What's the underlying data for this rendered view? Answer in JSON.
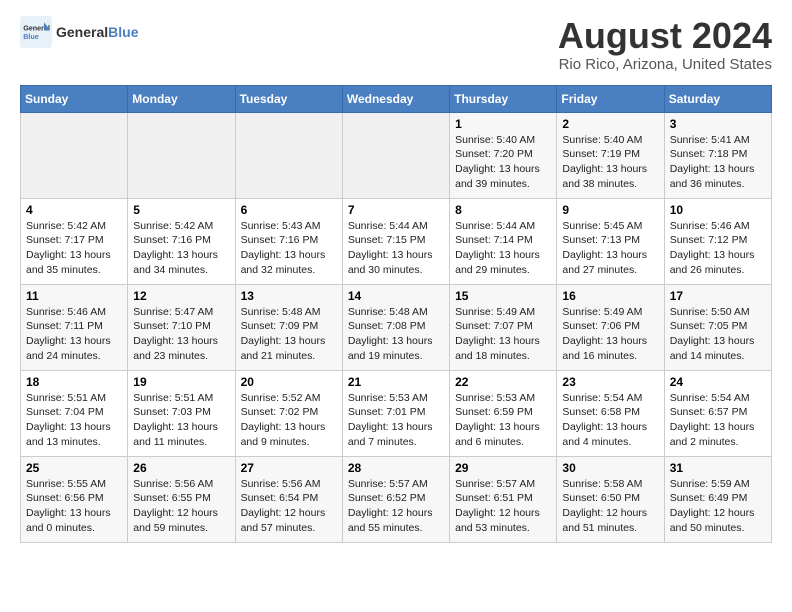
{
  "header": {
    "logo_line1": "General",
    "logo_line2": "Blue",
    "month_title": "August 2024",
    "location": "Rio Rico, Arizona, United States"
  },
  "weekdays": [
    "Sunday",
    "Monday",
    "Tuesday",
    "Wednesday",
    "Thursday",
    "Friday",
    "Saturday"
  ],
  "weeks": [
    [
      {
        "day": "",
        "info": ""
      },
      {
        "day": "",
        "info": ""
      },
      {
        "day": "",
        "info": ""
      },
      {
        "day": "",
        "info": ""
      },
      {
        "day": "1",
        "info": "Sunrise: 5:40 AM\nSunset: 7:20 PM\nDaylight: 13 hours\nand 39 minutes."
      },
      {
        "day": "2",
        "info": "Sunrise: 5:40 AM\nSunset: 7:19 PM\nDaylight: 13 hours\nand 38 minutes."
      },
      {
        "day": "3",
        "info": "Sunrise: 5:41 AM\nSunset: 7:18 PM\nDaylight: 13 hours\nand 36 minutes."
      }
    ],
    [
      {
        "day": "4",
        "info": "Sunrise: 5:42 AM\nSunset: 7:17 PM\nDaylight: 13 hours\nand 35 minutes."
      },
      {
        "day": "5",
        "info": "Sunrise: 5:42 AM\nSunset: 7:16 PM\nDaylight: 13 hours\nand 34 minutes."
      },
      {
        "day": "6",
        "info": "Sunrise: 5:43 AM\nSunset: 7:16 PM\nDaylight: 13 hours\nand 32 minutes."
      },
      {
        "day": "7",
        "info": "Sunrise: 5:44 AM\nSunset: 7:15 PM\nDaylight: 13 hours\nand 30 minutes."
      },
      {
        "day": "8",
        "info": "Sunrise: 5:44 AM\nSunset: 7:14 PM\nDaylight: 13 hours\nand 29 minutes."
      },
      {
        "day": "9",
        "info": "Sunrise: 5:45 AM\nSunset: 7:13 PM\nDaylight: 13 hours\nand 27 minutes."
      },
      {
        "day": "10",
        "info": "Sunrise: 5:46 AM\nSunset: 7:12 PM\nDaylight: 13 hours\nand 26 minutes."
      }
    ],
    [
      {
        "day": "11",
        "info": "Sunrise: 5:46 AM\nSunset: 7:11 PM\nDaylight: 13 hours\nand 24 minutes."
      },
      {
        "day": "12",
        "info": "Sunrise: 5:47 AM\nSunset: 7:10 PM\nDaylight: 13 hours\nand 23 minutes."
      },
      {
        "day": "13",
        "info": "Sunrise: 5:48 AM\nSunset: 7:09 PM\nDaylight: 13 hours\nand 21 minutes."
      },
      {
        "day": "14",
        "info": "Sunrise: 5:48 AM\nSunset: 7:08 PM\nDaylight: 13 hours\nand 19 minutes."
      },
      {
        "day": "15",
        "info": "Sunrise: 5:49 AM\nSunset: 7:07 PM\nDaylight: 13 hours\nand 18 minutes."
      },
      {
        "day": "16",
        "info": "Sunrise: 5:49 AM\nSunset: 7:06 PM\nDaylight: 13 hours\nand 16 minutes."
      },
      {
        "day": "17",
        "info": "Sunrise: 5:50 AM\nSunset: 7:05 PM\nDaylight: 13 hours\nand 14 minutes."
      }
    ],
    [
      {
        "day": "18",
        "info": "Sunrise: 5:51 AM\nSunset: 7:04 PM\nDaylight: 13 hours\nand 13 minutes."
      },
      {
        "day": "19",
        "info": "Sunrise: 5:51 AM\nSunset: 7:03 PM\nDaylight: 13 hours\nand 11 minutes."
      },
      {
        "day": "20",
        "info": "Sunrise: 5:52 AM\nSunset: 7:02 PM\nDaylight: 13 hours\nand 9 minutes."
      },
      {
        "day": "21",
        "info": "Sunrise: 5:53 AM\nSunset: 7:01 PM\nDaylight: 13 hours\nand 7 minutes."
      },
      {
        "day": "22",
        "info": "Sunrise: 5:53 AM\nSunset: 6:59 PM\nDaylight: 13 hours\nand 6 minutes."
      },
      {
        "day": "23",
        "info": "Sunrise: 5:54 AM\nSunset: 6:58 PM\nDaylight: 13 hours\nand 4 minutes."
      },
      {
        "day": "24",
        "info": "Sunrise: 5:54 AM\nSunset: 6:57 PM\nDaylight: 13 hours\nand 2 minutes."
      }
    ],
    [
      {
        "day": "25",
        "info": "Sunrise: 5:55 AM\nSunset: 6:56 PM\nDaylight: 13 hours\nand 0 minutes."
      },
      {
        "day": "26",
        "info": "Sunrise: 5:56 AM\nSunset: 6:55 PM\nDaylight: 12 hours\nand 59 minutes."
      },
      {
        "day": "27",
        "info": "Sunrise: 5:56 AM\nSunset: 6:54 PM\nDaylight: 12 hours\nand 57 minutes."
      },
      {
        "day": "28",
        "info": "Sunrise: 5:57 AM\nSunset: 6:52 PM\nDaylight: 12 hours\nand 55 minutes."
      },
      {
        "day": "29",
        "info": "Sunrise: 5:57 AM\nSunset: 6:51 PM\nDaylight: 12 hours\nand 53 minutes."
      },
      {
        "day": "30",
        "info": "Sunrise: 5:58 AM\nSunset: 6:50 PM\nDaylight: 12 hours\nand 51 minutes."
      },
      {
        "day": "31",
        "info": "Sunrise: 5:59 AM\nSunset: 6:49 PM\nDaylight: 12 hours\nand 50 minutes."
      }
    ]
  ]
}
